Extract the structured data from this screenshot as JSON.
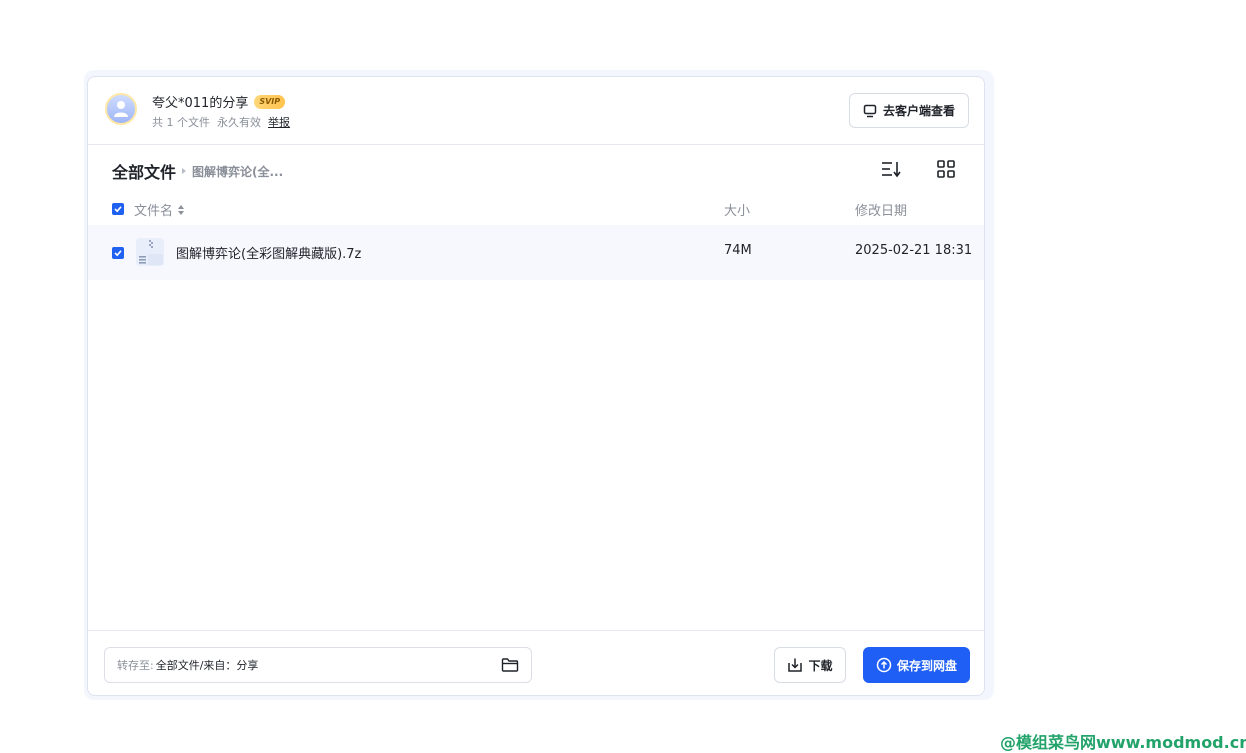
{
  "header": {
    "share_title": "夸父*011的分享",
    "vip_badge": "SVIP",
    "file_count": "共 1 个文件",
    "validity": "永久有效",
    "report_label": "举报",
    "client_button_label": "去客户端查看"
  },
  "breadcrumb": {
    "root": "全部文件",
    "current": "图解博弈论(全..."
  },
  "columns": {
    "name": "文件名",
    "size": "大小",
    "date": "修改日期"
  },
  "files": [
    {
      "name": "图解博弈论(全彩图解典藏版).7z",
      "size": "74M",
      "date": "2025-02-21 18:31",
      "checked": true
    }
  ],
  "footer": {
    "dest_label": "转存至:",
    "dest_path": "全部文件/来自：分享",
    "download_label": "下载",
    "save_label": "保存到网盘"
  },
  "watermark": "@模组菜鸟网www.modmod.cn",
  "colors": {
    "accent": "#1f5ff5",
    "vip": "#ffc24d"
  }
}
